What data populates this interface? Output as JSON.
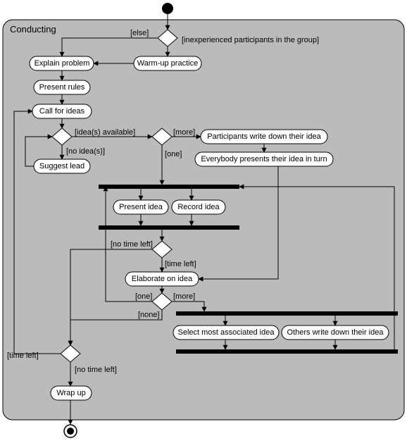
{
  "chart_data": {
    "type": "uml-activity-diagram",
    "container": "Conducting",
    "initial_node": true,
    "final_node": true,
    "activities": {
      "explain_problem": "Explain problem",
      "warmup": "Warm-up practice",
      "present_rules": "Present rules",
      "call_for_ideas": "Call for ideas",
      "suggest_lead": "Suggest lead",
      "participants_write": "Participants write down their idea",
      "everybody_presents": "Everybody presents their idea in turn",
      "present_idea": "Present idea",
      "record_idea": "Record idea",
      "elaborate": "Elaborate on idea",
      "select_most": "Select most associated idea",
      "others_write": "Others write down their idea",
      "wrap_up": "Wrap up"
    },
    "guards": {
      "else": "[else]",
      "inexperienced": "[inexperienced participants in the group]",
      "ideas_available": "[idea(s) available]",
      "no_ideas": "[no idea(s)]",
      "more1": "[more]",
      "one1": "[one]",
      "no_time_left1": "[no time left]",
      "time_left1": "[time left]",
      "one2": "[one]",
      "more2": "[more]",
      "none": "[none]",
      "time_left2": "[time left]",
      "no_time_left2": "[no time left]"
    },
    "fork_join_bars": 4,
    "decision_nodes": 6
  }
}
